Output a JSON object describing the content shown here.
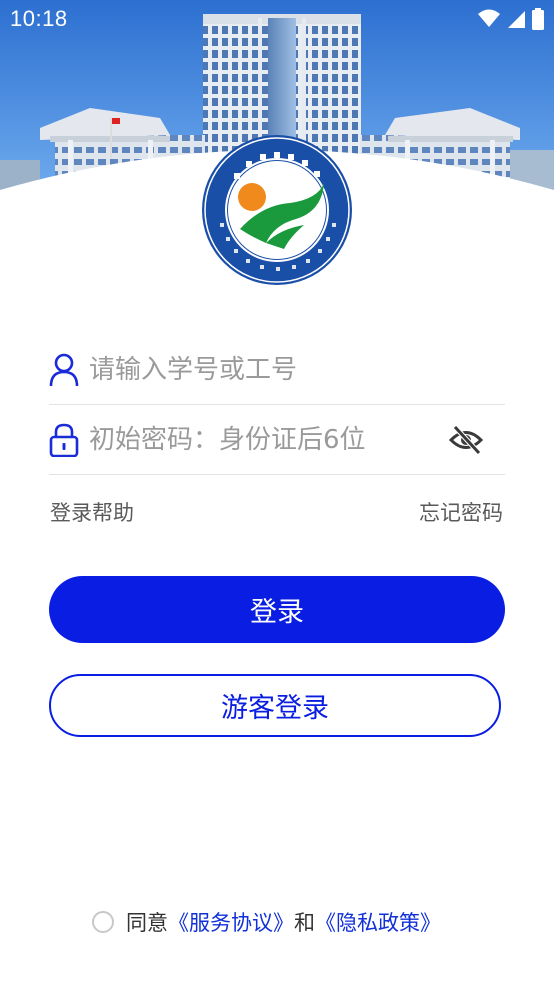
{
  "status_bar": {
    "time": "10:18"
  },
  "login_form": {
    "account_placeholder": "请输入学号或工号",
    "account_value": "",
    "password_placeholder": "初始密码：身份证后6位",
    "password_value": ""
  },
  "links": {
    "help": "登录帮助",
    "forgot": "忘记密码"
  },
  "buttons": {
    "login": "登录",
    "guest": "游客登录"
  },
  "agreement": {
    "prefix": "同意",
    "service": "《服务协议》",
    "and": "和",
    "privacy": "《隐私政策》"
  },
  "colors": {
    "primary": "#0a1ee3",
    "link": "#1030d8",
    "logo_blue": "#1a4fa8",
    "logo_green": "#1a9a3c",
    "logo_orange": "#f08a1d"
  },
  "icons": [
    "user-icon",
    "lock-icon",
    "eye-off-icon",
    "wifi-icon",
    "signal-icon",
    "battery-icon"
  ]
}
